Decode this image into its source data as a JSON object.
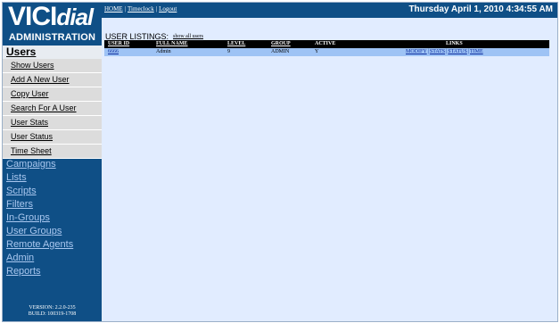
{
  "brand": {
    "logo_text_vici": "VICI",
    "logo_text_dial": "dial",
    "subtitle": "ADMINISTRATION"
  },
  "sidebar": {
    "section_title": "Users",
    "submenu": [
      {
        "label": "Show Users"
      },
      {
        "label": "Add A New User"
      },
      {
        "label": "Copy User"
      },
      {
        "label": "Search For A User"
      },
      {
        "label": "User Stats"
      },
      {
        "label": "User Status"
      },
      {
        "label": "Time Sheet"
      }
    ],
    "nav": [
      {
        "label": "Campaigns"
      },
      {
        "label": "Lists"
      },
      {
        "label": "Scripts"
      },
      {
        "label": "Filters"
      },
      {
        "label": "In-Groups"
      },
      {
        "label": "User Groups"
      },
      {
        "label": "Remote Agents"
      },
      {
        "label": "Admin"
      },
      {
        "label": "Reports"
      }
    ],
    "version": "VERSION: 2.2.0-235",
    "build": "BUILD: 100319-1708"
  },
  "topbar": {
    "links": [
      "HOME",
      "Timeclock",
      "Logout"
    ],
    "datetime": "Thursday April 1, 2010 4:34:55 AM"
  },
  "listing": {
    "title": "USER LISTINGS:",
    "show_all": "show all users",
    "columns": [
      "USER ID",
      "FULL NAME",
      "LEVEL",
      "GROUP",
      "ACTIVE",
      "LINKS"
    ],
    "rows": [
      {
        "user_id": "6666",
        "full_name": "Admin",
        "level": "9",
        "group": "ADMIN",
        "active": "Y",
        "links": [
          "MODIFY",
          "STATS",
          "STATUS",
          "TIME"
        ]
      }
    ]
  },
  "colors": {
    "sidebar_bg": "#0f4f86",
    "content_bg": "#e1ecff",
    "row_bg": "#9ec3f5",
    "nav_link": "#a9c7ef"
  }
}
